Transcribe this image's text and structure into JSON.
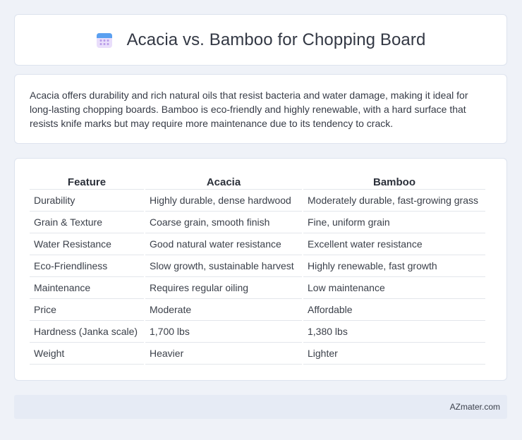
{
  "header": {
    "title": "Acacia vs. Bamboo for Chopping Board",
    "icon": "calendar-icon"
  },
  "summary": {
    "text": "Acacia offers durability and rich natural oils that resist bacteria and water damage, making it ideal for long-lasting chopping boards. Bamboo is eco-friendly and highly renewable, with a hard surface that resists knife marks but may require more maintenance due to its tendency to crack."
  },
  "table": {
    "headers": [
      "Feature",
      "Acacia",
      "Bamboo"
    ],
    "rows": [
      [
        "Durability",
        "Highly durable, dense hardwood",
        "Moderately durable, fast-growing grass"
      ],
      [
        "Grain & Texture",
        "Coarse grain, smooth finish",
        "Fine, uniform grain"
      ],
      [
        "Water Resistance",
        "Good natural water resistance",
        "Excellent water resistance"
      ],
      [
        "Eco-Friendliness",
        "Slow growth, sustainable harvest",
        "Highly renewable, fast growth"
      ],
      [
        "Maintenance",
        "Requires regular oiling",
        "Low maintenance"
      ],
      [
        "Price",
        "Moderate",
        "Affordable"
      ],
      [
        "Hardness (Janka scale)",
        "1,700 lbs",
        "1,380 lbs"
      ],
      [
        "Weight",
        "Heavier",
        "Lighter"
      ]
    ]
  },
  "footer": {
    "brand": "AZmater.com"
  },
  "colors": {
    "background": "#eff2f8",
    "card": "#ffffff",
    "footer": "#e6ebf5",
    "icon_blue": "#5aa0f0",
    "icon_purple": "#b79be8"
  }
}
